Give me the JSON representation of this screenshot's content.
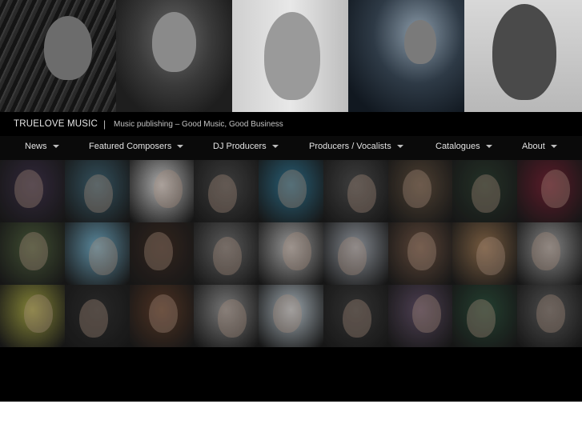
{
  "header": {
    "site_title": "TRUELOVE MUSIC",
    "separator": "|",
    "tagline": "Music publishing – Good Music, Good Business"
  },
  "nav": {
    "items": [
      {
        "label": "News",
        "icon": "chevron-down-icon"
      },
      {
        "label": "Featured Composers",
        "icon": "chevron-down-icon"
      },
      {
        "label": "DJ Producers",
        "icon": "chevron-down-icon"
      },
      {
        "label": "Producers / Vocalists",
        "icon": "chevron-down-icon"
      },
      {
        "label": "Catalogues",
        "icon": "chevron-down-icon"
      },
      {
        "label": "About",
        "icon": "chevron-down-icon"
      }
    ]
  },
  "hero": {
    "photos": [
      {
        "name": "hero-photo-1"
      },
      {
        "name": "hero-photo-2"
      },
      {
        "name": "hero-photo-3"
      },
      {
        "name": "hero-photo-4"
      },
      {
        "name": "hero-photo-5"
      }
    ]
  },
  "grid": {
    "rows": 3,
    "columns": 9,
    "tile_colors": [
      [
        "#3a2f45",
        "#3c5f6e",
        "#c9c9c9",
        "#474747",
        "#2f6f8a",
        "#4a4a4a",
        "#5a4a3a",
        "#2a3a2e",
        "#6a1f30"
      ],
      [
        "#4a5a3a",
        "#6aa0b8",
        "#3a2a22",
        "#6a6a6a",
        "#b0b0b0",
        "#9aa0a8",
        "#6a5040",
        "#8a6a4a",
        "#9a9a9a"
      ],
      [
        "#9a9a40",
        "#2e2e2e",
        "#5a3a28",
        "#8a8a8a",
        "#b8c4cc",
        "#3a3a3a",
        "#5a4a60",
        "#2a4a38",
        "#5a5a5a"
      ]
    ]
  }
}
